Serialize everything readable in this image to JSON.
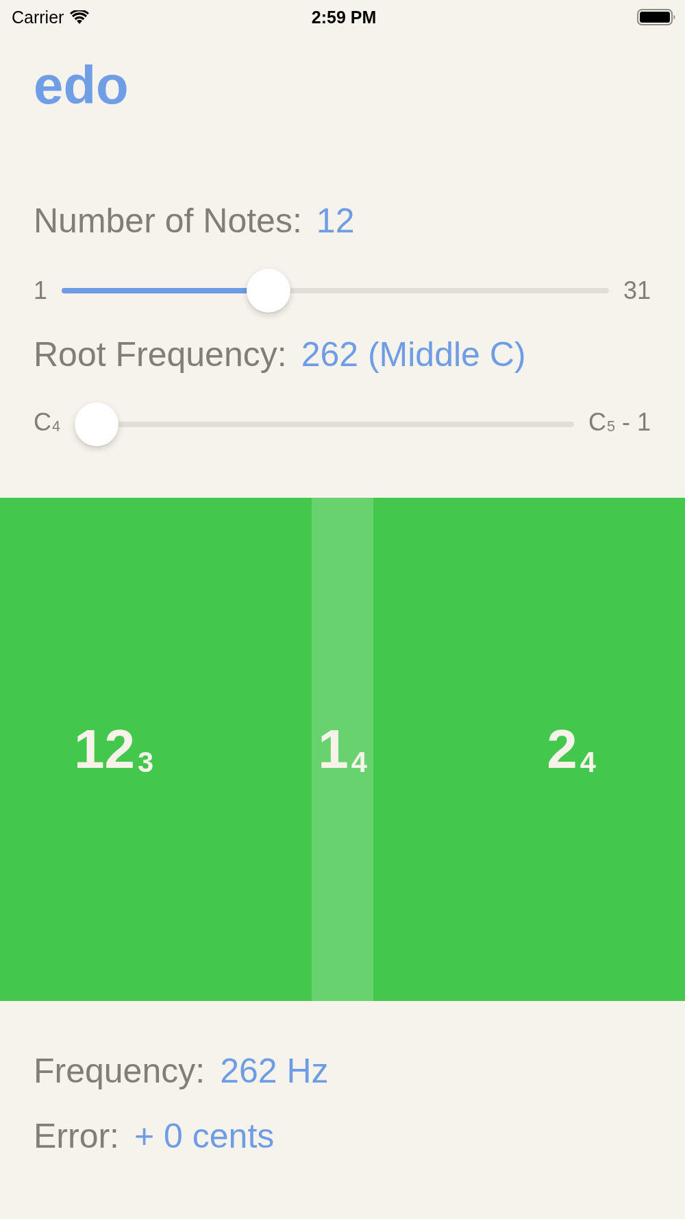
{
  "status_bar": {
    "carrier": "Carrier",
    "time": "2:59 PM"
  },
  "title": "edo",
  "controls": [
    {
      "label": "Number of Notes:",
      "value": "12",
      "min_label": "1",
      "max_label": "31",
      "level": 0.367
    },
    {
      "label": "Root Frequency:",
      "value": "262 (Middle C)",
      "min_label": "C$_{4}$",
      "max_label": "C$_{5}$ - 1",
      "level": 0
    }
  ],
  "keys": [
    {
      "label": "12$_{3}$",
      "selected": false
    },
    {
      "label": "1$_{4}$",
      "selected": true
    },
    {
      "label": "2$_{4}$",
      "selected": false
    }
  ],
  "readouts": [
    {
      "label": "Frequency:",
      "value": "262 Hz"
    },
    {
      "label": "Error:",
      "value": "+ 0 cents"
    }
  ]
}
